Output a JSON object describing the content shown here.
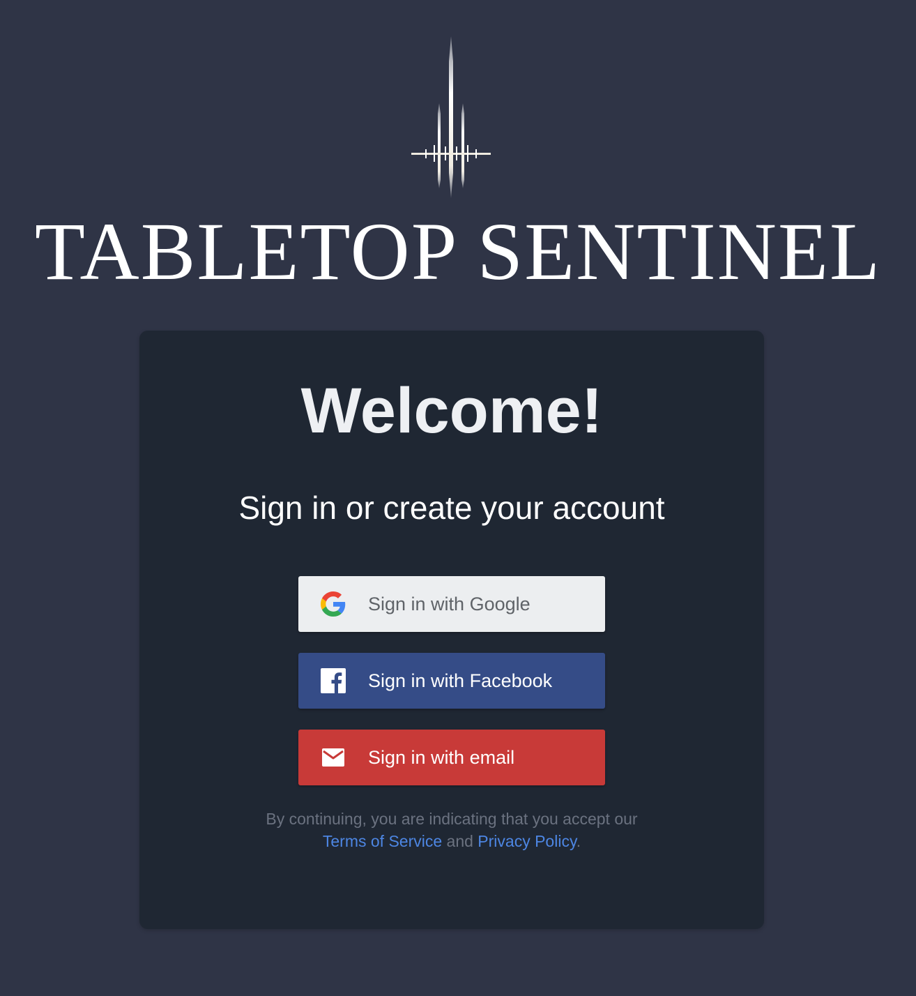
{
  "brand": {
    "title": "TABLETOP SENTINEL",
    "logo_icon": "sword-crest-icon"
  },
  "card": {
    "heading": "Welcome!",
    "subtitle": "Sign in or create your account"
  },
  "buttons": {
    "google": {
      "label": "Sign in with Google",
      "icon": "google-icon",
      "background": "#eceef0"
    },
    "facebook": {
      "label": "Sign in with Facebook",
      "icon": "facebook-icon",
      "background": "#354c87"
    },
    "email": {
      "label": "Sign in with email",
      "icon": "mail-icon",
      "background": "#c83a38"
    }
  },
  "legal": {
    "line1": "By continuing, you are indicating that you accept our",
    "terms_link": "Terms of Service",
    "conjunction": "and",
    "privacy_link": "Privacy Policy",
    "period": "."
  },
  "colors": {
    "page_background": "#2f3446",
    "card_background": "#1f2733",
    "link": "#4d86e3"
  }
}
